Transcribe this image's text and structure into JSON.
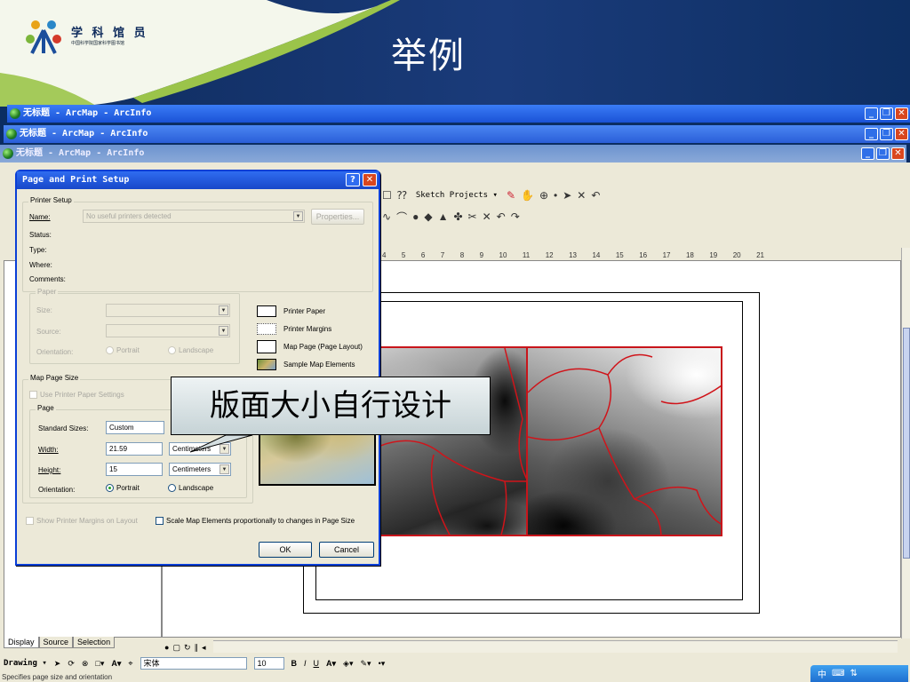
{
  "slide": {
    "title": "举例",
    "logo_name": "学 科 馆 员",
    "logo_sub": "中国科学院国家科学图书馆"
  },
  "windows": [
    {
      "title": "无标题 - ArcMap - ArcInfo"
    },
    {
      "title": "无标题 - ArcMap - ArcInfo"
    },
    {
      "title": "无标题 - ArcMap - ArcInfo"
    }
  ],
  "arcmap": {
    "sketch_projects_label": "Sketch Projects ▾",
    "ruler_ticks": [
      "4",
      "5",
      "6",
      "7",
      "8",
      "9",
      "10",
      "11",
      "12",
      "13",
      "14",
      "15",
      "16",
      "17",
      "18",
      "19",
      "20",
      "21"
    ],
    "toc_tabs": [
      "Display",
      "Source",
      "Selection"
    ],
    "drawing_label": "Drawing ▾",
    "font_name": "宋体",
    "font_size": "10",
    "status_text": "Specifies page size and orientation"
  },
  "dialog": {
    "title": "Page and Print Setup",
    "printer_setup": {
      "legend": "Printer Setup",
      "name_label": "Name:",
      "name_value": "No useful printers detected",
      "properties_button": "Properties...",
      "status_label": "Status:",
      "type_label": "Type:",
      "where_label": "Where:",
      "comments_label": "Comments:"
    },
    "paper": {
      "legend": "Paper",
      "size_label": "Size:",
      "source_label": "Source:",
      "orientation_label": "Orientation:",
      "portrait": "Portrait",
      "landscape": "Landscape"
    },
    "legend_items": [
      "Printer Paper",
      "Printer Margins",
      "Map Page (Page Layout)",
      "Sample Map Elements"
    ],
    "map_page_size": {
      "legend": "Map Page Size",
      "use_printer_paper": "Use Printer Paper Settings",
      "page_legend": "Page",
      "standard_sizes_label": "Standard Sizes:",
      "standard_sizes_value": "Custom",
      "width_label": "Width:",
      "width_value": "21.59",
      "width_unit": "Centimeters",
      "height_label": "Height:",
      "height_value": "15",
      "height_unit": "Centimeters",
      "orientation_label": "Orientation:",
      "portrait": "Portrait",
      "landscape": "Landscape"
    },
    "show_printer_margins": "Show Printer Margins on Layout",
    "scale_map_elements": "Scale Map Elements proportionally to changes in Page Size",
    "ok_button": "OK",
    "cancel_button": "Cancel"
  },
  "callout": {
    "text": "版面大小自行设计"
  }
}
